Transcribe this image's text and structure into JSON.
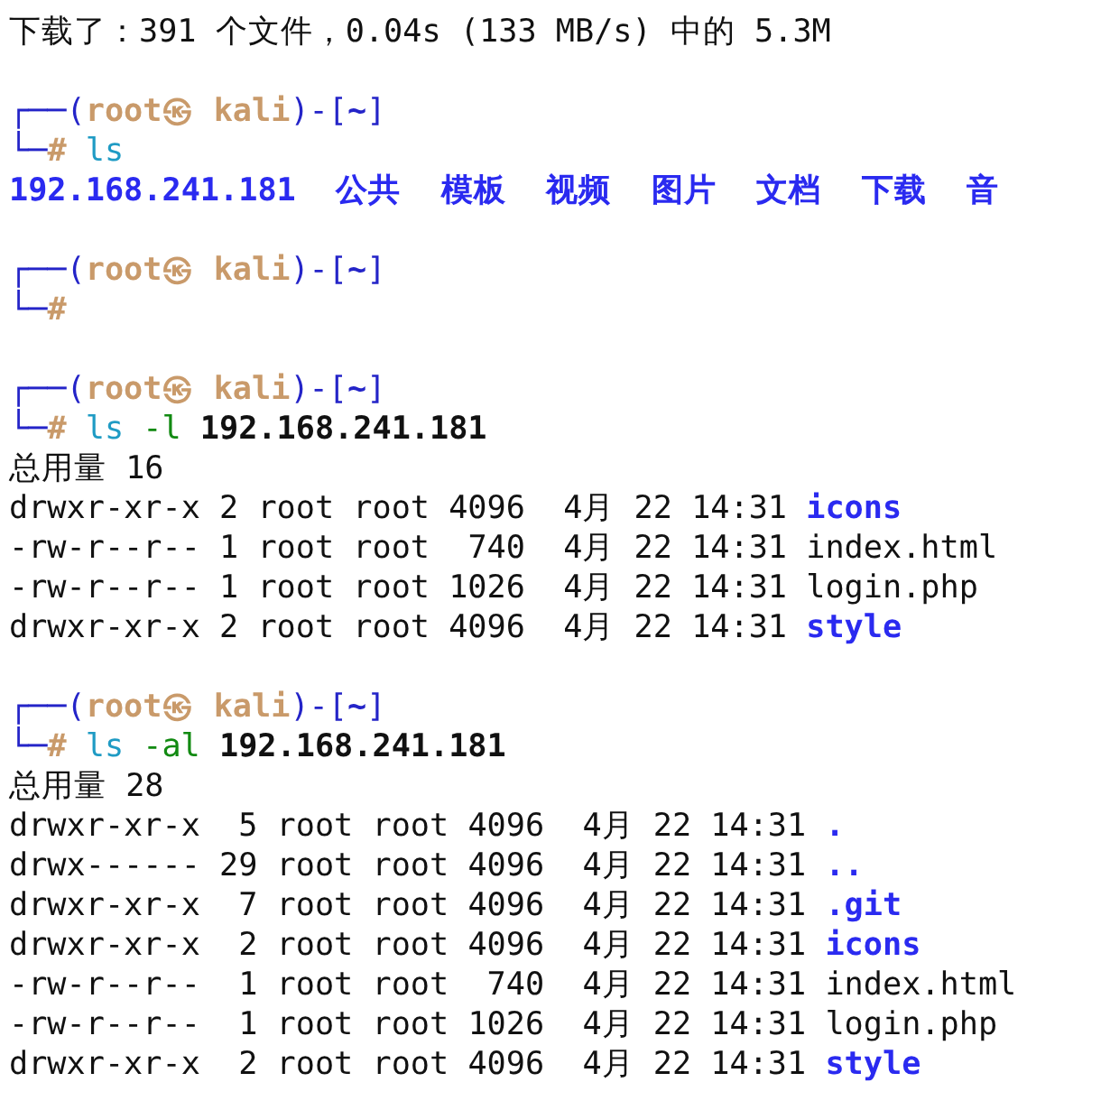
{
  "terminal": {
    "lines": [
      {
        "kind": "output",
        "text": "下载了：391 个文件，0.04s (133 MB/s) 中的 5.3M"
      },
      {
        "kind": "blank"
      },
      {
        "kind": "prompt",
        "open": "┌──(",
        "user": "root㉿ kali",
        "separator": ")-[",
        "path": "~",
        "close": "]"
      },
      {
        "kind": "command",
        "frame": "└─",
        "symbol": "#",
        "command": "ls"
      },
      {
        "kind": "names",
        "entries": [
          "192.168.241.181",
          "公共",
          "模板",
          "视频",
          "图片",
          "文档",
          "下载",
          "音"
        ]
      },
      {
        "kind": "blank"
      },
      {
        "kind": "prompt",
        "open": "┌──(",
        "user": "root㉿ kali",
        "separator": ")-[",
        "path": "~",
        "close": "]"
      },
      {
        "kind": "command",
        "frame": "└─",
        "symbol": "#"
      },
      {
        "kind": "blank"
      },
      {
        "kind": "prompt",
        "open": "┌──(",
        "user": "root㉿ kali",
        "separator": ")-[",
        "path": "~",
        "close": "]"
      },
      {
        "kind": "command",
        "frame": "└─",
        "symbol": "#",
        "command": "ls",
        "option": "-l",
        "argument": "192.168.241.181"
      },
      {
        "kind": "output",
        "text": "总用量 16"
      },
      {
        "kind": "listing",
        "rows": [
          {
            "perms": "drwxr-xr-x",
            "links": "2",
            "owner": "root",
            "group": "root",
            "size": "4096",
            "month": "4月",
            "day": "22",
            "time": "14:31",
            "name": "icons",
            "kind": "directory"
          },
          {
            "perms": "-rw-r--r--",
            "links": "1",
            "owner": "root",
            "group": "root",
            "size": "740",
            "month": "4月",
            "day": "22",
            "time": "14:31",
            "name": "index.html",
            "kind": "file"
          },
          {
            "perms": "-rw-r--r--",
            "links": "1",
            "owner": "root",
            "group": "root",
            "size": "1026",
            "month": "4月",
            "day": "22",
            "time": "14:31",
            "name": "login.php",
            "kind": "file"
          },
          {
            "perms": "drwxr-xr-x",
            "links": "2",
            "owner": "root",
            "group": "root",
            "size": "4096",
            "month": "4月",
            "day": "22",
            "time": "14:31",
            "name": "style",
            "kind": "directory"
          }
        ]
      },
      {
        "kind": "blank"
      },
      {
        "kind": "prompt",
        "open": "┌──(",
        "user": "root㉿ kali",
        "separator": ")-[",
        "path": "~",
        "close": "]"
      },
      {
        "kind": "command",
        "frame": "└─",
        "symbol": "#",
        "command": "ls",
        "option": "-al",
        "argument": "192.168.241.181"
      },
      {
        "kind": "output",
        "text": "总用量 28"
      },
      {
        "kind": "listing",
        "rows": [
          {
            "perms": "drwxr-xr-x",
            "links": "5",
            "owner": "root",
            "group": "root",
            "size": "4096",
            "month": "4月",
            "day": "22",
            "time": "14:31",
            "name": ".",
            "kind": "directory"
          },
          {
            "perms": "drwx------",
            "links": "29",
            "owner": "root",
            "group": "root",
            "size": "4096",
            "month": "4月",
            "day": "22",
            "time": "14:31",
            "name": "..",
            "kind": "directory"
          },
          {
            "perms": "drwxr-xr-x",
            "links": "7",
            "owner": "root",
            "group": "root",
            "size": "4096",
            "month": "4月",
            "day": "22",
            "time": "14:31",
            "name": ".git",
            "kind": "directory"
          },
          {
            "perms": "drwxr-xr-x",
            "links": "2",
            "owner": "root",
            "group": "root",
            "size": "4096",
            "month": "4月",
            "day": "22",
            "time": "14:31",
            "name": "icons",
            "kind": "directory"
          },
          {
            "perms": "-rw-r--r--",
            "links": "1",
            "owner": "root",
            "group": "root",
            "size": "740",
            "month": "4月",
            "day": "22",
            "time": "14:31",
            "name": "index.html",
            "kind": "file"
          },
          {
            "perms": "-rw-r--r--",
            "links": "1",
            "owner": "root",
            "group": "root",
            "size": "1026",
            "month": "4月",
            "day": "22",
            "time": "14:31",
            "name": "login.php",
            "kind": "file"
          },
          {
            "perms": "drwxr-xr-x",
            "links": "2",
            "owner": "root",
            "group": "root",
            "size": "4096",
            "month": "4月",
            "day": "22",
            "time": "14:31",
            "name": "style",
            "kind": "directory"
          }
        ]
      }
    ]
  }
}
